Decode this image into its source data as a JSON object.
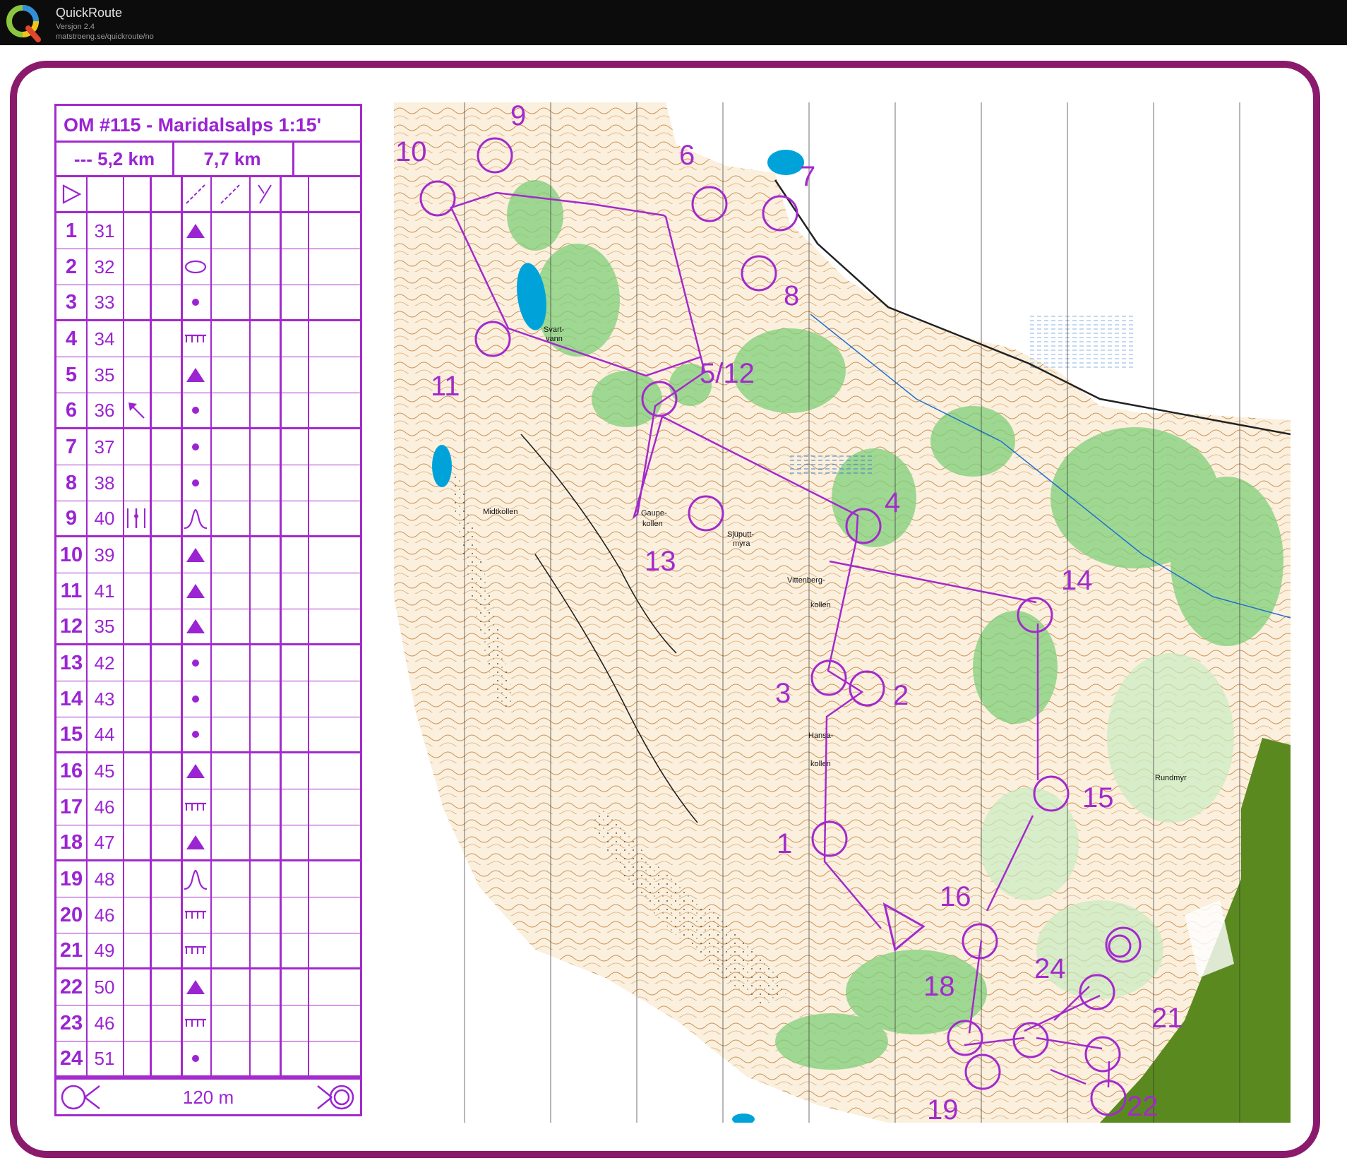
{
  "app": {
    "name": "QuickRoute",
    "version": "Versjon 2.4",
    "url": "matstroeng.se/quickroute/no"
  },
  "colors": {
    "frame": "#8a1a6c",
    "course": "#a32acc",
    "titlebar": "#0c0c0c"
  },
  "description_sheet": {
    "title": "OM #115 - Maridalsalps 1:15'",
    "length_left": "--- 5,2 km",
    "length_right": "7,7 km",
    "start_icon": "start-triangle-icon",
    "controls": [
      {
        "num": "1",
        "code": "31",
        "symbol": "knoll-triangle-icon"
      },
      {
        "num": "2",
        "code": "32",
        "symbol": "depression-ellipse-icon"
      },
      {
        "num": "3",
        "code": "33",
        "symbol": "dot-icon"
      },
      {
        "num": "4",
        "code": "34",
        "symbol": "cliff-icon"
      },
      {
        "num": "5",
        "code": "35",
        "symbol": "knoll-triangle-icon"
      },
      {
        "num": "6",
        "code": "36",
        "symbol": "dot-icon"
      },
      {
        "num": "7",
        "code": "37",
        "symbol": "dot-icon"
      },
      {
        "num": "8",
        "code": "38",
        "symbol": "dot-icon"
      },
      {
        "num": "9",
        "code": "40",
        "symbol": "spur-icon"
      },
      {
        "num": "10",
        "code": "39",
        "symbol": "knoll-triangle-icon"
      },
      {
        "num": "11",
        "code": "41",
        "symbol": "knoll-triangle-icon"
      },
      {
        "num": "12",
        "code": "35",
        "symbol": "knoll-triangle-icon"
      },
      {
        "num": "13",
        "code": "42",
        "symbol": "dot-icon"
      },
      {
        "num": "14",
        "code": "43",
        "symbol": "dot-icon"
      },
      {
        "num": "15",
        "code": "44",
        "symbol": "dot-icon"
      },
      {
        "num": "16",
        "code": "45",
        "symbol": "knoll-triangle-icon"
      },
      {
        "num": "17",
        "code": "46",
        "symbol": "cliff-icon"
      },
      {
        "num": "18",
        "code": "47",
        "symbol": "knoll-triangle-icon"
      },
      {
        "num": "19",
        "code": "48",
        "symbol": "spur-icon"
      },
      {
        "num": "20",
        "code": "46",
        "symbol": "cliff-icon"
      },
      {
        "num": "21",
        "code": "49",
        "symbol": "cliff-icon"
      },
      {
        "num": "22",
        "code": "50",
        "symbol": "knoll-triangle-icon"
      },
      {
        "num": "23",
        "code": "46",
        "symbol": "cliff-icon"
      },
      {
        "num": "24",
        "code": "51",
        "symbol": "dot-icon"
      }
    ],
    "extra_symbols": {
      "6": "northwest-arrow-icon",
      "9": "between-features-icon"
    },
    "finish_text": "120 m"
  },
  "map": {
    "controls": [
      {
        "label": "1"
      },
      {
        "label": "2"
      },
      {
        "label": "3"
      },
      {
        "label": "4"
      },
      {
        "label": "5/12"
      },
      {
        "label": "6"
      },
      {
        "label": "7"
      },
      {
        "label": "8"
      },
      {
        "label": "9"
      },
      {
        "label": "10"
      },
      {
        "label": "11"
      },
      {
        "label": "13"
      },
      {
        "label": "14"
      },
      {
        "label": "15"
      },
      {
        "label": "16"
      },
      {
        "label": "18"
      },
      {
        "label": "19"
      },
      {
        "label": "21"
      },
      {
        "label": "22"
      },
      {
        "label": "24"
      }
    ],
    "place_names": [
      "Svart-",
      "vann",
      "Midtkollen",
      "Gaupe-",
      "kollen",
      "Sjuputt-",
      "myra",
      "Vittenberg-",
      "kollen",
      "Hansa-",
      "kollen",
      "Rundmyr"
    ]
  }
}
